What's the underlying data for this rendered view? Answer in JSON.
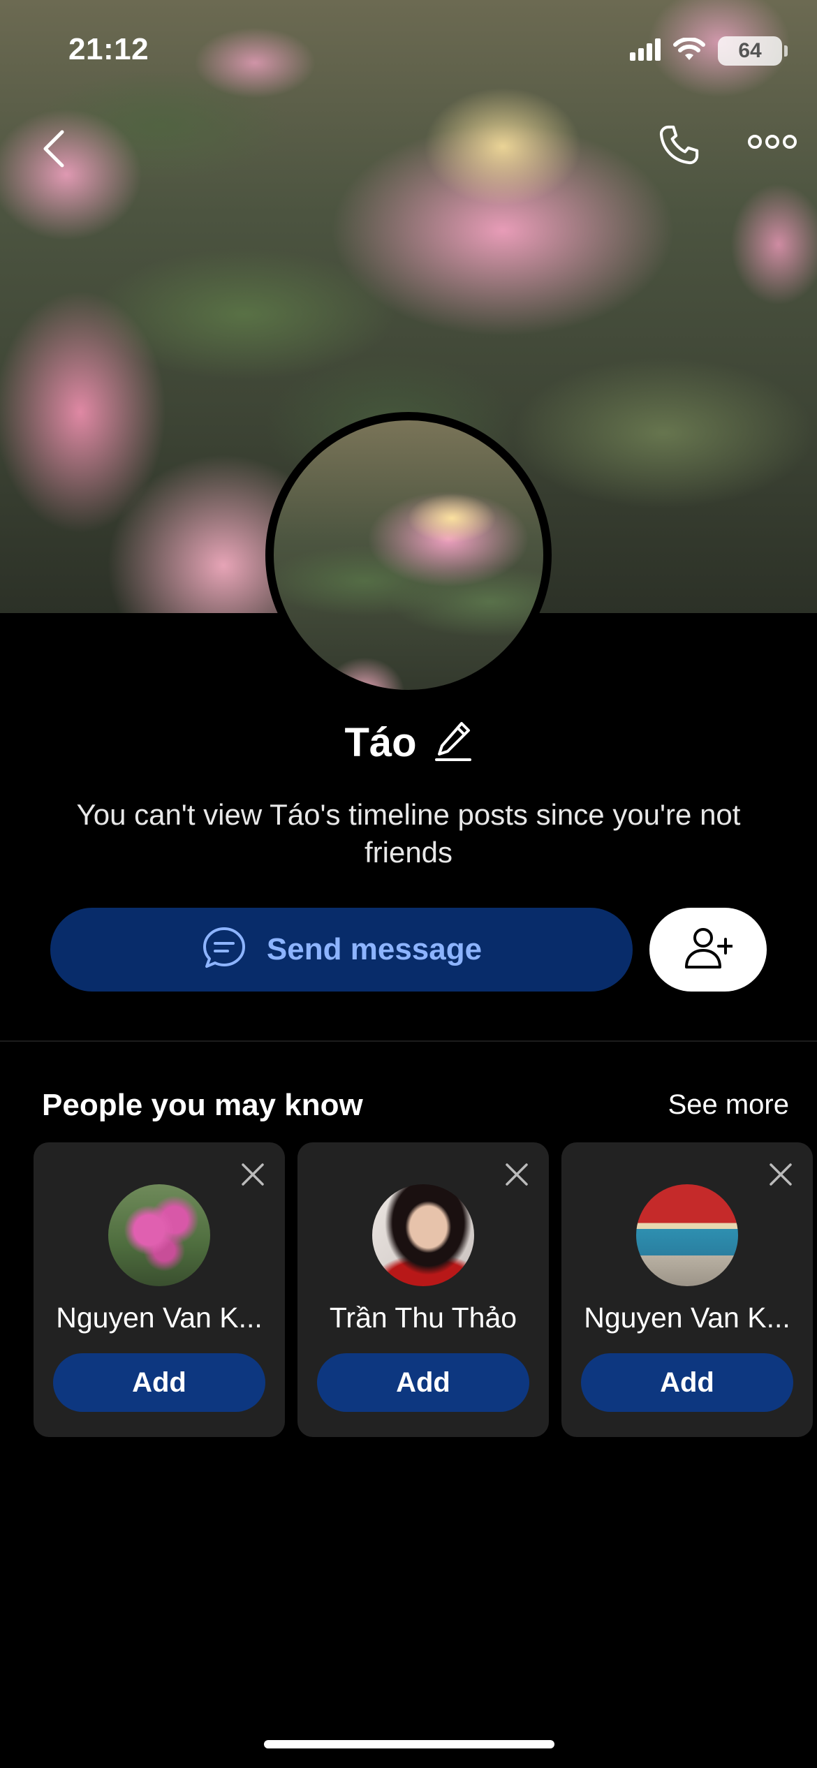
{
  "status_bar": {
    "time": "21:12",
    "battery": "64",
    "icons": [
      "signal-icon",
      "wifi-icon",
      "battery-icon"
    ]
  },
  "nav": {
    "icons": [
      "back-chevron-icon",
      "phone-icon",
      "more-dots-icon"
    ]
  },
  "profile": {
    "name": "Táo",
    "edit_icon": "pencil-icon",
    "info_text": "You can't view Táo's timeline posts since you're not friends",
    "send_message_label": "Send message",
    "send_icon": "chat-bubble-icon",
    "add_friend_icon": "add-person-icon"
  },
  "suggestions": {
    "title": "People you may know",
    "see_more": "See more",
    "people": [
      {
        "name": "Nguyen Van K...",
        "add_label": "Add"
      },
      {
        "name": "Trần Thu Thảo",
        "add_label": "Add"
      },
      {
        "name": "Nguyen Van K...",
        "add_label": "Add"
      }
    ]
  },
  "colors": {
    "background": "#000000",
    "send_button": "#082c6a",
    "send_label": "#8db4ff",
    "add_button": "#0d3780",
    "card": "#222222"
  }
}
